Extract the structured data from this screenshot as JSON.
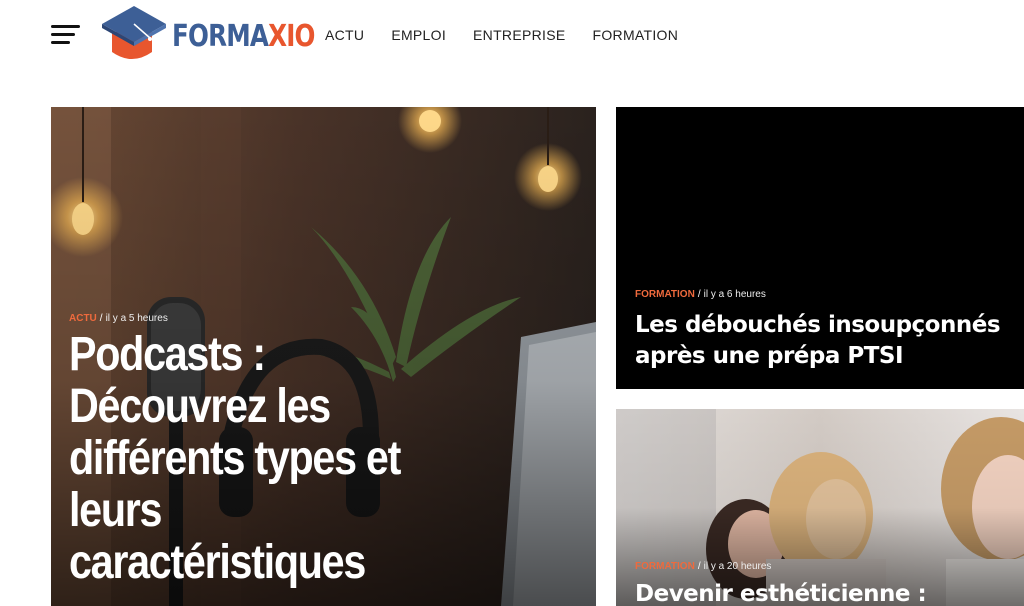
{
  "header": {
    "menu_icon": "hamburger-menu-icon",
    "logo": {
      "part1": "FORMA",
      "part2": "XIO",
      "icon": "graduation-cap-icon"
    },
    "nav": [
      "ACTU",
      "EMPLOI",
      "ENTREPRISE",
      "FORMATION"
    ]
  },
  "articles": {
    "main": {
      "category": "ACTU",
      "time": "il y a 5 heures",
      "title": "Podcasts : Découvrez les différents types et leurs caractéristiques"
    },
    "top_right": {
      "category": "FORMATION",
      "time": "il y a 6 heures",
      "title": "Les débouchés insoupçonnés après une prépa PTSI"
    },
    "bottom_right": {
      "category": "FORMATION",
      "time": "il y a 20 heures",
      "title": "Devenir esthéticienne :"
    }
  },
  "colors": {
    "brand_blue": "#3d5f96",
    "brand_orange": "#e8562e",
    "category": "#ef6a3d"
  }
}
